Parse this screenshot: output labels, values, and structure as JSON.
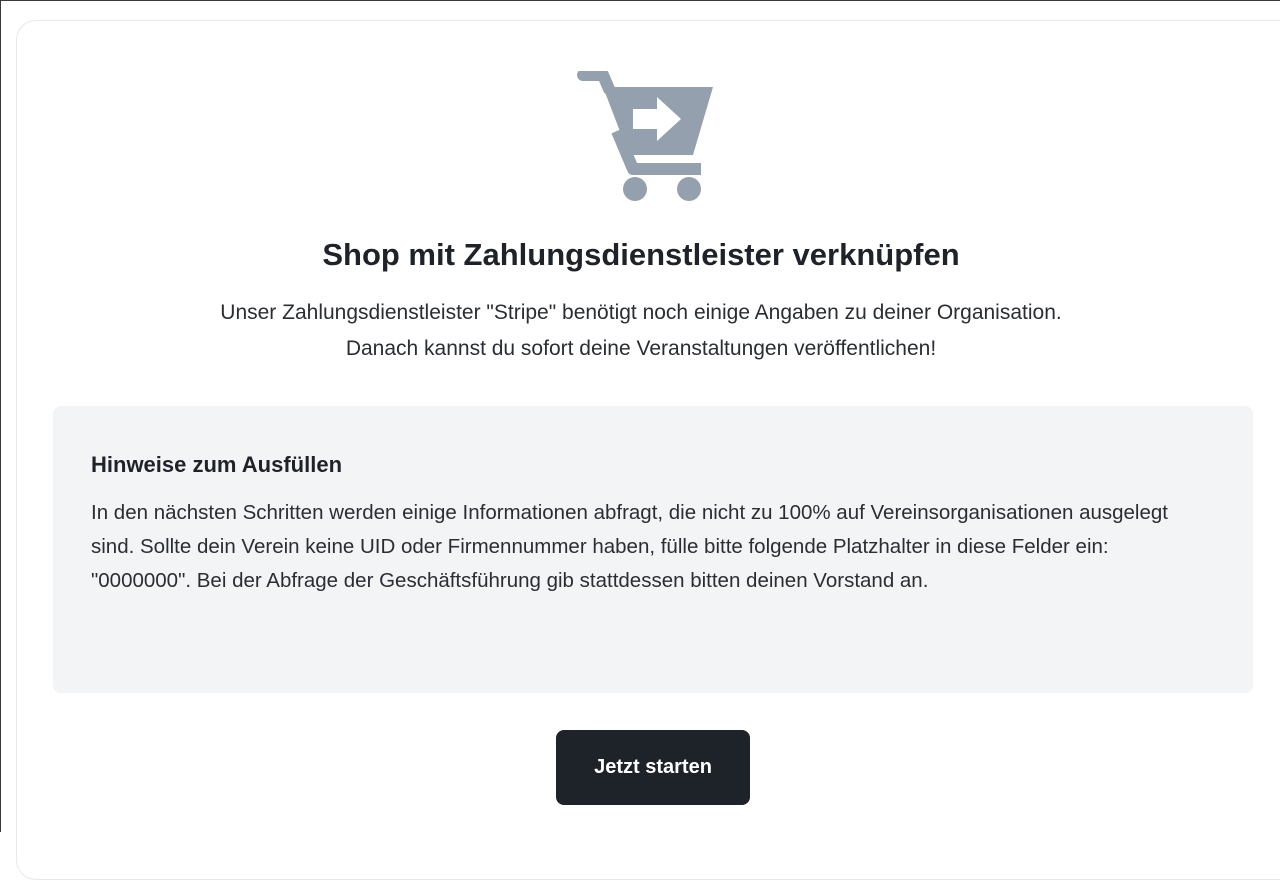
{
  "hero": {
    "icon": "cart-arrow-right-icon",
    "icon_color": "#95a0ae",
    "title": "Shop mit Zahlungsdienstleister verknüpfen",
    "subtitle_line1": "Unser Zahlungsdienstleister \"Stripe\" benötigt noch einige Angaben zu deiner Organisation.",
    "subtitle_line2": "Danach kannst du sofort deine Veranstaltungen veröffentlichen!"
  },
  "hint": {
    "title": "Hinweise zum Ausfüllen",
    "text": "In den nächsten Schritten werden einige Informationen abfragt, die nicht zu 100% auf Vereinsorganisationen ausgelegt sind. Sollte dein Verein keine UID oder Firmennummer haben, fülle bitte folgende Platzhalter in diese Felder ein: \"0000000\". Bei der Abfrage der Geschäftsführung gib stattdessen bitten deinen Vorstand an.",
    "background": "#f3f4f6"
  },
  "actions": {
    "start_label": "Jetzt starten",
    "start_color": "#1e2329"
  }
}
